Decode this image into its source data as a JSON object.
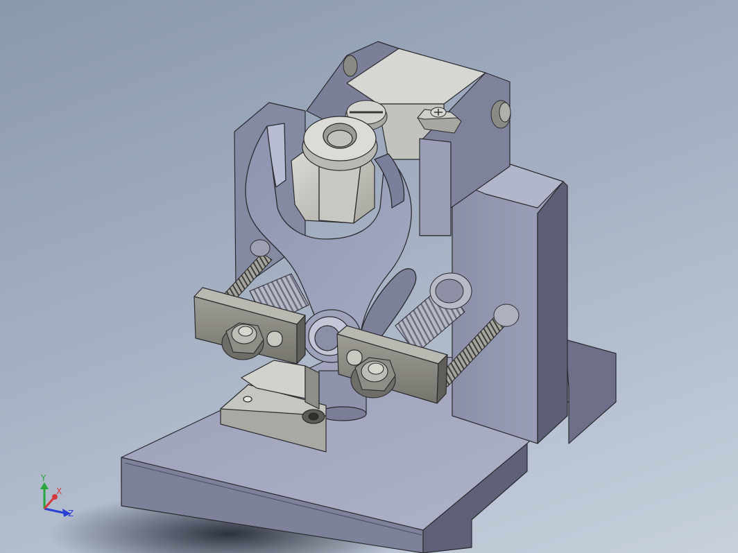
{
  "viewport": {
    "colors": {
      "background_top": "#8a98ad",
      "background_bottom": "#c7d0dc",
      "part_blue_light": "#a7acc4",
      "part_blue_mid": "#8f93ad",
      "part_blue_dark": "#5e6178",
      "metal_light": "#d8d8d4",
      "metal_mid": "#a9a9a3",
      "metal_dark": "#6f6f69",
      "edge": "#2a2a2e"
    }
  },
  "triad": {
    "x_label": "X",
    "y_label": "Y",
    "z_label": "Z",
    "x_color": "#d43a3a",
    "y_color": "#27a53a",
    "z_color": "#2a3fd4"
  }
}
